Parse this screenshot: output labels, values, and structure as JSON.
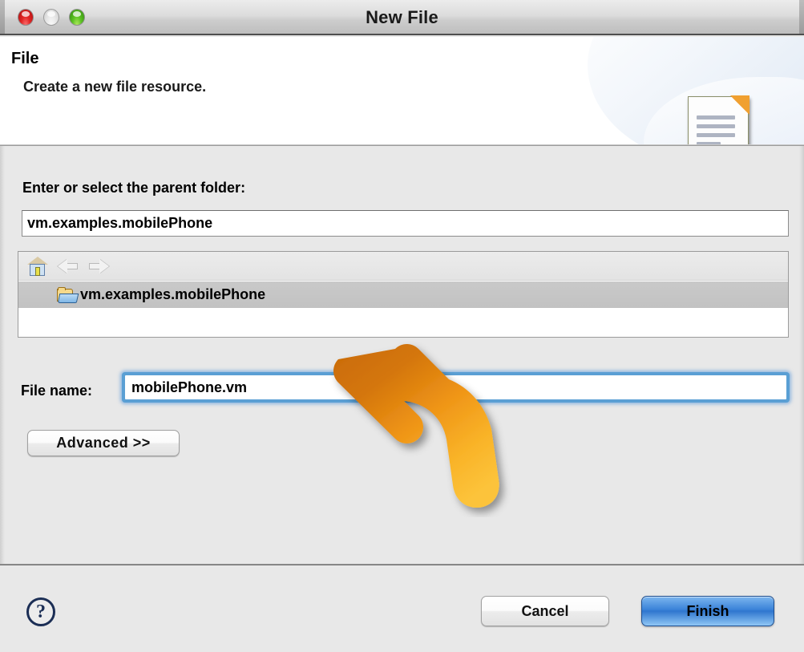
{
  "window": {
    "title": "New File",
    "controls": [
      {
        "name": "close",
        "color": "#e22525"
      },
      {
        "name": "minimize",
        "color": "#eaeaea"
      },
      {
        "name": "zoom",
        "color": "#5ec324"
      }
    ]
  },
  "banner": {
    "title": "File",
    "subtitle": "Create a new file resource.",
    "icon": "new-file-document-icon"
  },
  "form": {
    "parent_folder_label": "Enter or select the parent folder:",
    "parent_folder_value": "vm.examples.mobilePhone",
    "parent_folder_placeholder": "",
    "tree_toolbar": [
      {
        "name": "home-icon",
        "label": "Home",
        "enabled": true
      },
      {
        "name": "back-arrow-icon",
        "label": "Back",
        "enabled": false
      },
      {
        "name": "forward-arrow-icon",
        "label": "Forward",
        "enabled": false
      }
    ],
    "tree_items": [
      {
        "label": "vm.examples.mobilePhone",
        "icon": "open-folder-icon",
        "selected": true
      }
    ],
    "file_name_label": "File name:",
    "file_name_value": "mobilePhone.vm",
    "file_name_placeholder": "",
    "file_name_focused": true,
    "advanced_button": "Advanced >>"
  },
  "footer": {
    "help_label": "?",
    "cancel_label": "Cancel",
    "finish_label": "Finish"
  },
  "annotation": {
    "type": "curved-arrow",
    "points_to": "file-name-input",
    "color_start": "#c96a05",
    "color_end": "#fcc033"
  },
  "colors": {
    "dialog_background": "#e8e8e8",
    "banner_background": "#ffffff",
    "selection": "#c5c5c5",
    "focus_ring": "#4a90d9",
    "default_button": "#3a82d8"
  }
}
